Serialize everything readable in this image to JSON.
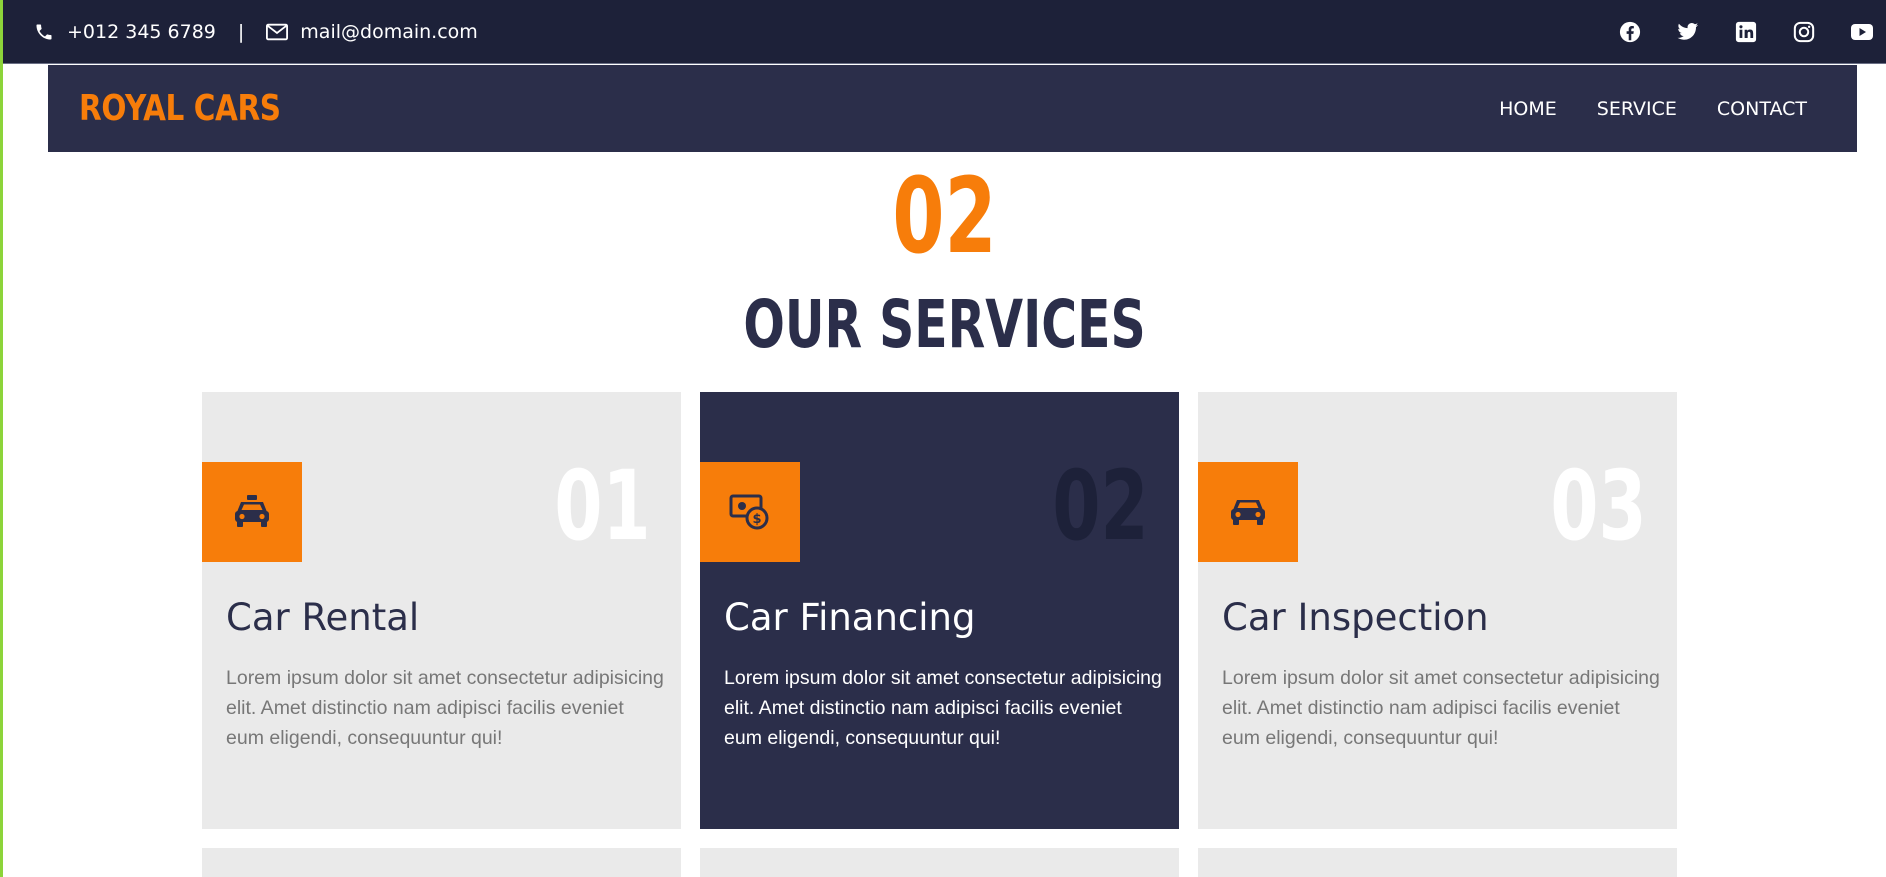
{
  "topbar": {
    "phone": "+012 345 6789",
    "separator": "|",
    "email": "mail@domain.com",
    "phone_icon": "phone-icon",
    "email_icon": "envelope-icon",
    "social": [
      "facebook-icon",
      "twitter-icon",
      "linkedin-icon",
      "instagram-icon",
      "youtube-icon"
    ]
  },
  "navbar": {
    "brand": "ROYAL CARS",
    "menu": [
      "HOME",
      "SERVICE",
      "CONTACT"
    ]
  },
  "section": {
    "number": "02",
    "title": "OUR SERVICES"
  },
  "services": [
    {
      "number": "01",
      "title": "Car Rental",
      "icon": "taxi-icon",
      "description": "Lorem ipsum dolor sit amet consectetur adipisicing elit. Amet distinctio nam adipisci facilis eveniet eum eligendi, consequuntur qui!"
    },
    {
      "number": "02",
      "title": "Car Financing",
      "icon": "money-bill-icon",
      "description": "Lorem ipsum dolor sit amet consectetur adipisicing elit. Amet distinctio nam adipisci facilis eveniet eum eligendi, consequuntur qui!"
    },
    {
      "number": "03",
      "title": "Car Inspection",
      "icon": "car-icon",
      "description": "Lorem ipsum dolor sit amet consectetur adipisicing elit. Amet distinctio nam adipisci facilis eveniet eum eligendi, consequuntur qui!"
    }
  ],
  "colors": {
    "accent": "#f77d0a",
    "navy": "#2b2e4a",
    "topbar": "#1d2139",
    "card": "#eaeaea"
  }
}
